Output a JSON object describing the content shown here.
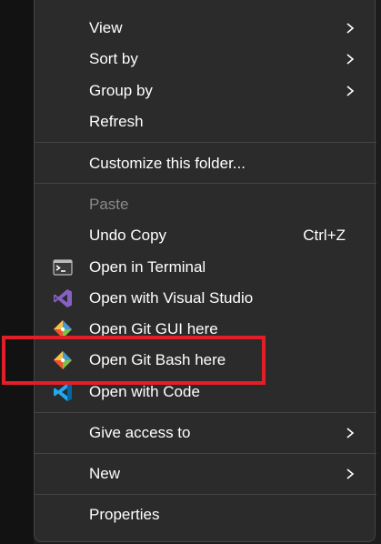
{
  "menu": {
    "items": [
      {
        "label": "View",
        "submenu": true
      },
      {
        "label": "Sort by",
        "submenu": true
      },
      {
        "label": "Group by",
        "submenu": true
      },
      {
        "label": "Refresh"
      },
      {
        "label": "Customize this folder..."
      },
      {
        "label": "Paste",
        "disabled": true
      },
      {
        "label": "Undo Copy",
        "shortcut": "Ctrl+Z"
      },
      {
        "label": "Open in Terminal",
        "icon": "terminal-icon"
      },
      {
        "label": "Open with Visual Studio",
        "icon": "visual-studio-icon"
      },
      {
        "label": "Open Git GUI here",
        "icon": "git-gui-icon"
      },
      {
        "label": "Open Git Bash here",
        "icon": "git-bash-icon",
        "highlighted": true
      },
      {
        "label": "Open with Code",
        "icon": "vscode-icon"
      },
      {
        "label": "Give access to",
        "submenu": true
      },
      {
        "label": "New",
        "submenu": true
      },
      {
        "label": "Properties"
      }
    ]
  },
  "colors": {
    "menu_background": "#2b2b2b",
    "text": "#ffffff",
    "disabled_text": "#8a8a8a",
    "highlight_border": "#e21f26",
    "visual_studio": "#8661c5",
    "vscode": "#23a9f2",
    "git": "#f05133"
  }
}
